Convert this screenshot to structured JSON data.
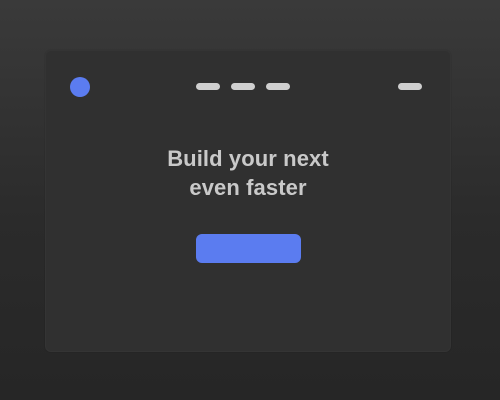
{
  "hero": {
    "headline_line1": "Build your next",
    "headline_line2": "even faster"
  },
  "header": {
    "logo_icon": "circle-logo-icon",
    "nav_items": [
      "placeholder",
      "placeholder",
      "placeholder"
    ],
    "menu_icon": "menu-placeholder-icon"
  },
  "colors": {
    "accent": "#5b7cf0",
    "card_bg": "#303030",
    "text": "#c9c9c9",
    "placeholder": "#cfcfcf"
  }
}
